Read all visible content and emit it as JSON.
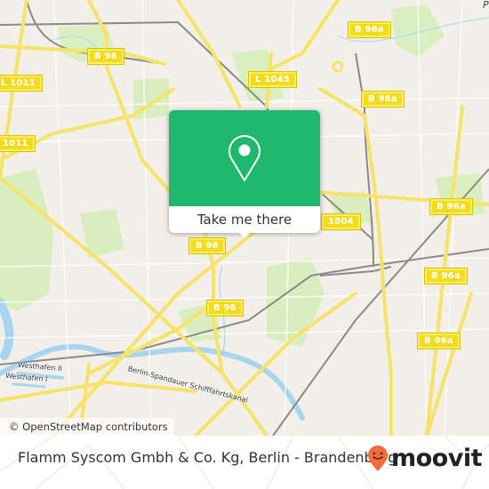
{
  "map": {
    "attribution": "© OpenStreetMap contributors",
    "road_labels": [
      {
        "id": "b96-top",
        "text": "B 96"
      },
      {
        "id": "l1011-a",
        "text": "L 1011"
      },
      {
        "id": "l1011-b",
        "text": "1011"
      },
      {
        "id": "l1045",
        "text": "L 1045"
      },
      {
        "id": "b96a-top",
        "text": "B 96a"
      },
      {
        "id": "b96a-2",
        "text": "B 96a"
      },
      {
        "id": "l1004",
        "text": "1004"
      },
      {
        "id": "b96a-3",
        "text": "B 96a"
      },
      {
        "id": "b96a-4",
        "text": "B 96a"
      },
      {
        "id": "b96a-5",
        "text": "B 96a"
      },
      {
        "id": "b96-mid",
        "text": "B 96"
      },
      {
        "id": "b96-low",
        "text": "B 96"
      }
    ],
    "water_labels": [
      {
        "id": "westhafen-2",
        "text": "Westhafen II"
      },
      {
        "id": "westhafen-1",
        "text": "Westhafen I"
      },
      {
        "id": "canal",
        "text": "Berlin-Spandauer Schifffahrtskanal"
      }
    ],
    "corner_label": "P",
    "colors": {
      "background": "#f2efe9",
      "major_road": "#f7e26a",
      "park": "#d7eebb",
      "water": "#a8d5ee",
      "rail": "#8a8a8a"
    }
  },
  "popup": {
    "icon": "map-pin-icon",
    "button_label": "Take me there",
    "accent_color": "#1fb76b"
  },
  "footer": {
    "caption": "Flamm Syscom Gmbh & Co. Kg, Berlin - Brandenburg",
    "brand": "moovit",
    "brand_icon": "moovit-pin-icon",
    "brand_color": "#f26b3a"
  }
}
